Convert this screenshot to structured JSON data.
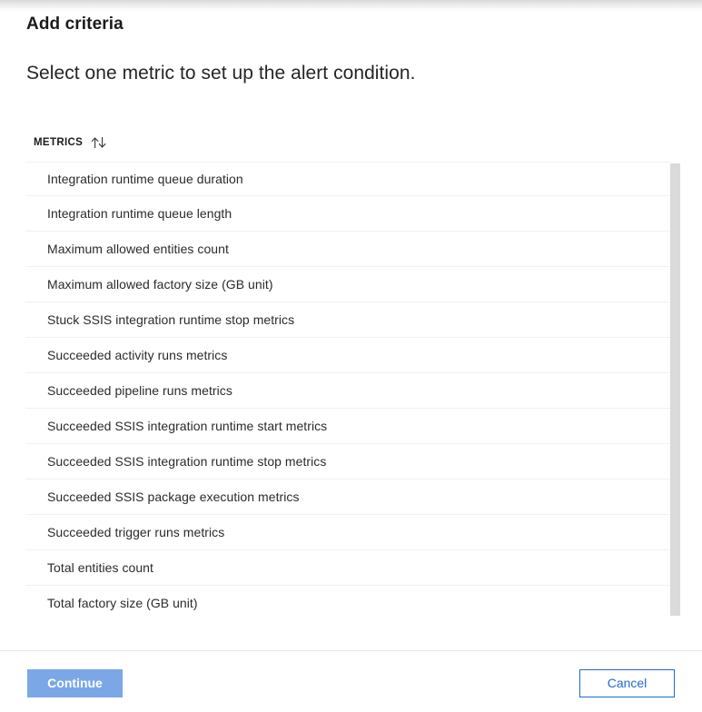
{
  "blade": {
    "title": "Add criteria",
    "subtitle": "Select one metric to set up the alert condition."
  },
  "list": {
    "column_header": "METRICS",
    "sort_icon": "sort-ascending-descending-icon",
    "items": [
      {
        "label": "Integration runtime queue duration"
      },
      {
        "label": "Integration runtime queue length"
      },
      {
        "label": "Maximum allowed entities count"
      },
      {
        "label": "Maximum allowed factory size (GB unit)"
      },
      {
        "label": "Stuck SSIS integration runtime stop metrics"
      },
      {
        "label": "Succeeded activity runs metrics"
      },
      {
        "label": "Succeeded pipeline runs metrics"
      },
      {
        "label": "Succeeded SSIS integration runtime start metrics"
      },
      {
        "label": "Succeeded SSIS integration runtime stop metrics"
      },
      {
        "label": "Succeeded SSIS package execution metrics"
      },
      {
        "label": "Succeeded trigger runs metrics"
      },
      {
        "label": "Total entities count"
      },
      {
        "label": "Total factory size (GB unit)"
      }
    ]
  },
  "footer": {
    "continue_label": "Continue",
    "cancel_label": "Cancel"
  },
  "colors": {
    "primary_disabled": "#7ba7e7",
    "secondary_border": "#1f69d0",
    "secondary_text": "#1f69d0",
    "row_divider": "#f1f1f1",
    "scrollbar_thumb": "#dadada",
    "text_primary": "#1b1b1b",
    "text_row": "#2b2b2b"
  }
}
